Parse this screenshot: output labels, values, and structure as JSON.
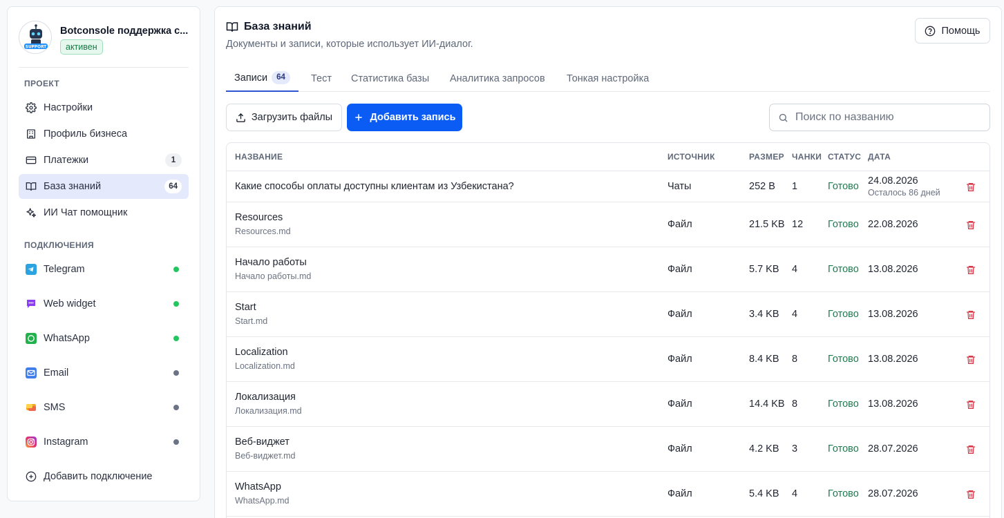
{
  "brand": {
    "name": "Botconsole поддержка c...",
    "status": "активен",
    "avatar_text": "SUPPORT"
  },
  "sidebar": {
    "project_label": "ПРОЕКТ",
    "project_items": [
      {
        "label": "Настройки",
        "icon": "gear-icon"
      },
      {
        "label": "Профиль бизнеса",
        "icon": "building-icon"
      },
      {
        "label": "Платежки",
        "icon": "credit-card-icon",
        "badge": "1"
      },
      {
        "label": "База знаний",
        "icon": "book-icon",
        "badge": "64",
        "active": true
      },
      {
        "label": "ИИ Чат помощник",
        "icon": "sparkles-icon"
      }
    ],
    "connections_label": "ПОДКЛЮЧЕНИЯ",
    "connections": [
      {
        "label": "Telegram",
        "status": "on",
        "color": "#2AA3E0"
      },
      {
        "label": "Web widget",
        "status": "on",
        "color": "#8B3DF0"
      },
      {
        "label": "WhatsApp",
        "status": "on",
        "color": "#22B14C"
      },
      {
        "label": "Email",
        "status": "off",
        "color": "#3F7EEA"
      },
      {
        "label": "SMS",
        "status": "off",
        "color": "#F5A623"
      },
      {
        "label": "Instagram",
        "status": "off",
        "color": "#D6249F"
      }
    ],
    "add_connection": "Добавить подключение"
  },
  "header": {
    "title": "База знаний",
    "subtitle": "Документы и записи, которые использует ИИ-диалог.",
    "help": "Помощь"
  },
  "tabs": [
    {
      "label": "Записи",
      "count": "64",
      "active": true
    },
    {
      "label": "Тест"
    },
    {
      "label": "Статистика базы"
    },
    {
      "label": "Аналитика запросов"
    },
    {
      "label": "Тонкая настройка"
    }
  ],
  "toolbar": {
    "upload": "Загрузить файлы",
    "add": "Добавить запись",
    "search_placeholder": "Поиск по названию"
  },
  "table": {
    "columns": [
      "НАЗВАНИЕ",
      "ИСТОЧНИК",
      "РАЗМЕР",
      "ЧАНКИ",
      "СТАТУС",
      "ДАТА"
    ],
    "rows": [
      {
        "name": "Какие способы оплаты доступны клиентам из Узбекистана?",
        "file": "",
        "source": "Чаты",
        "size": "252 B",
        "chunks": "1",
        "status": "Готово",
        "date": "24.08.2026",
        "note": "Осталось 86 дней"
      },
      {
        "name": "Resources",
        "file": "Resources.md",
        "source": "Файл",
        "size": "21.5 KB",
        "chunks": "12",
        "status": "Готово",
        "date": "22.08.2026",
        "note": ""
      },
      {
        "name": "Начало работы",
        "file": "Начало работы.md",
        "source": "Файл",
        "size": "5.7 KB",
        "chunks": "4",
        "status": "Готово",
        "date": "13.08.2026",
        "note": ""
      },
      {
        "name": "Start",
        "file": "Start.md",
        "source": "Файл",
        "size": "3.4 KB",
        "chunks": "4",
        "status": "Готово",
        "date": "13.08.2026",
        "note": ""
      },
      {
        "name": "Localization",
        "file": "Localization.md",
        "source": "Файл",
        "size": "8.4 KB",
        "chunks": "8",
        "status": "Готово",
        "date": "13.08.2026",
        "note": ""
      },
      {
        "name": "Локализация",
        "file": "Локализация.md",
        "source": "Файл",
        "size": "14.4 KB",
        "chunks": "8",
        "status": "Готово",
        "date": "13.08.2026",
        "note": ""
      },
      {
        "name": "Веб-виджет",
        "file": "Веб-виджет.md",
        "source": "Файл",
        "size": "4.2 KB",
        "chunks": "3",
        "status": "Готово",
        "date": "28.07.2026",
        "note": ""
      },
      {
        "name": "WhatsApp",
        "file": "WhatsApp.md",
        "source": "Файл",
        "size": "5.4 KB",
        "chunks": "4",
        "status": "Готово",
        "date": "28.07.2026",
        "note": ""
      }
    ]
  },
  "colors": {
    "accent": "#0A5CF5",
    "active_bg": "#E4E9FB",
    "ok": "#1F7A4F",
    "danger": "#D63A4A"
  }
}
